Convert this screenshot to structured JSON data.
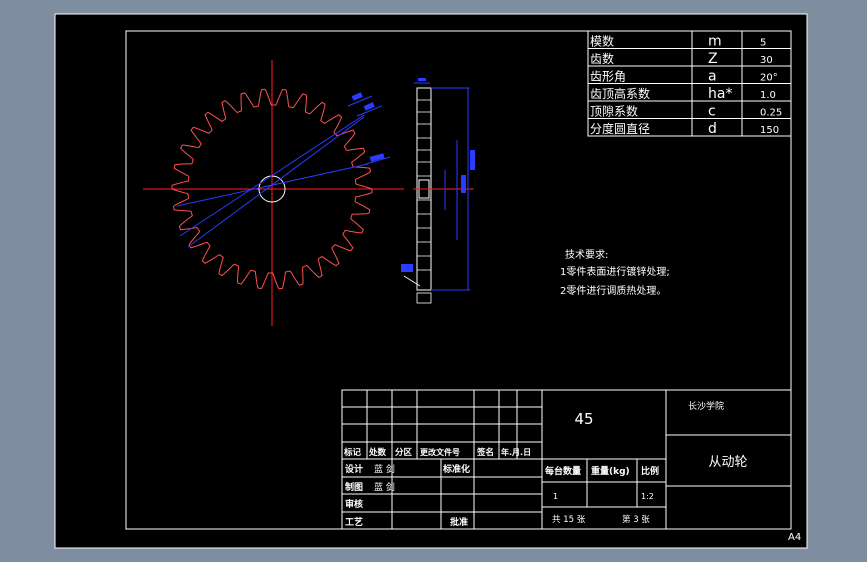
{
  "colors": {
    "background": "#7f8da0",
    "sheet": "#000000",
    "line": "#ffffff",
    "center_line": "#ff2020",
    "dimension": "#2a3cff",
    "profile": "#ff4a4a"
  },
  "params": {
    "rows": [
      {
        "name": "模数",
        "symbol": "m",
        "value": "5"
      },
      {
        "name": "齿数",
        "symbol": "Z",
        "value": "30"
      },
      {
        "name": "齿形角",
        "symbol": "a",
        "value": "20°"
      },
      {
        "name": "齿顶高系数",
        "symbol": "ha*",
        "value": "1.0"
      },
      {
        "name": "顶隙系数",
        "symbol": "c",
        "value": "0.25"
      },
      {
        "name": "分度圆直径",
        "symbol": "d",
        "value": "150"
      }
    ]
  },
  "notes": {
    "title": "技术要求:",
    "lines": [
      "1零件表面进行镀锌处理;",
      "2零件进行调质热处理。"
    ]
  },
  "title_block": {
    "material": "45",
    "school": "长沙学院",
    "part_name": "从动轮",
    "rev_headers": [
      "标记",
      "处数",
      "分区",
      "更改文件号",
      "签名",
      "年.月.日"
    ],
    "design_label": "设计",
    "design_name": "蓝 剑",
    "standard_label": "标准化",
    "drawing_label": "制图",
    "drawing_name": "蓝 剑",
    "check_label": "审核",
    "process_label": "工艺",
    "approve_label": "批准",
    "qty_label": "每台数量",
    "weight_label": "重量(kg)",
    "scale_label": "比例",
    "qty_value": "1",
    "scale_value": "1:2",
    "sheets_total": "共 15 张",
    "sheet_no": "第 3 张"
  },
  "sheet_size": "A4"
}
